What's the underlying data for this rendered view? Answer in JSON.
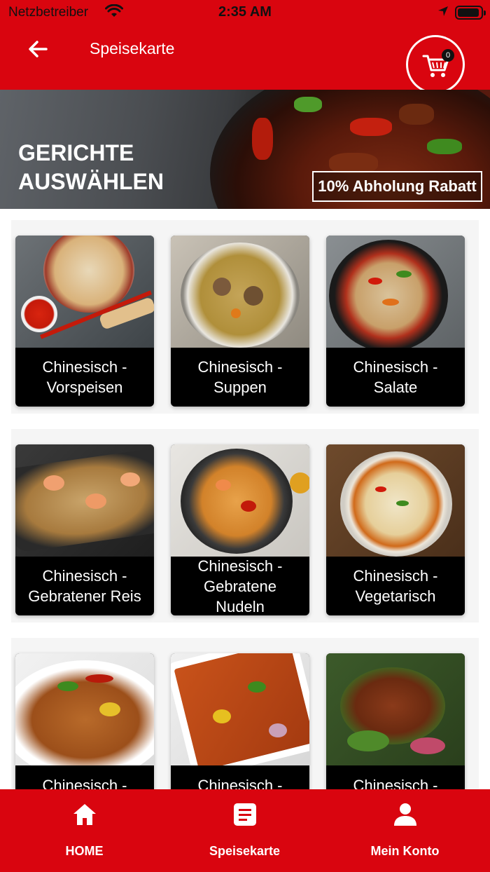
{
  "status_bar": {
    "carrier": "Netzbetreiber",
    "time": "2:35 AM"
  },
  "header": {
    "title": "Speisekarte",
    "cart_count": "0"
  },
  "banner": {
    "title": "GERICHTE\nAUSWÄHLEN",
    "badge": "10% Abholung Rabatt"
  },
  "categories": [
    {
      "label": "Chinesisch -\nVorspeisen",
      "name": "category-card-vorspeisen"
    },
    {
      "label": "Chinesisch -\nSuppen",
      "name": "category-card-suppen"
    },
    {
      "label": "Chinesisch -\nSalate",
      "name": "category-card-salate"
    },
    {
      "label": "Chinesisch -\nGebratener Reis",
      "name": "category-card-gebratener-reis"
    },
    {
      "label": "Chinesisch -\nGebratene\nNudeln",
      "name": "category-card-gebratene-nudeln"
    },
    {
      "label": "Chinesisch -\nVegetarisch",
      "name": "category-card-vegetarisch"
    },
    {
      "label": "Chinesisch -",
      "name": "category-card-7"
    },
    {
      "label": "Chinesisch -",
      "name": "category-card-8"
    },
    {
      "label": "Chinesisch -",
      "name": "category-card-9"
    }
  ],
  "bottom_nav": {
    "items": [
      {
        "label": "HOME",
        "icon": "home-icon"
      },
      {
        "label": "Speisekarte",
        "icon": "menu-document-icon"
      },
      {
        "label": "Mein Konto",
        "icon": "user-icon"
      }
    ]
  },
  "colors": {
    "brand_red": "#d9050f",
    "card_label_bg": "#000000"
  }
}
